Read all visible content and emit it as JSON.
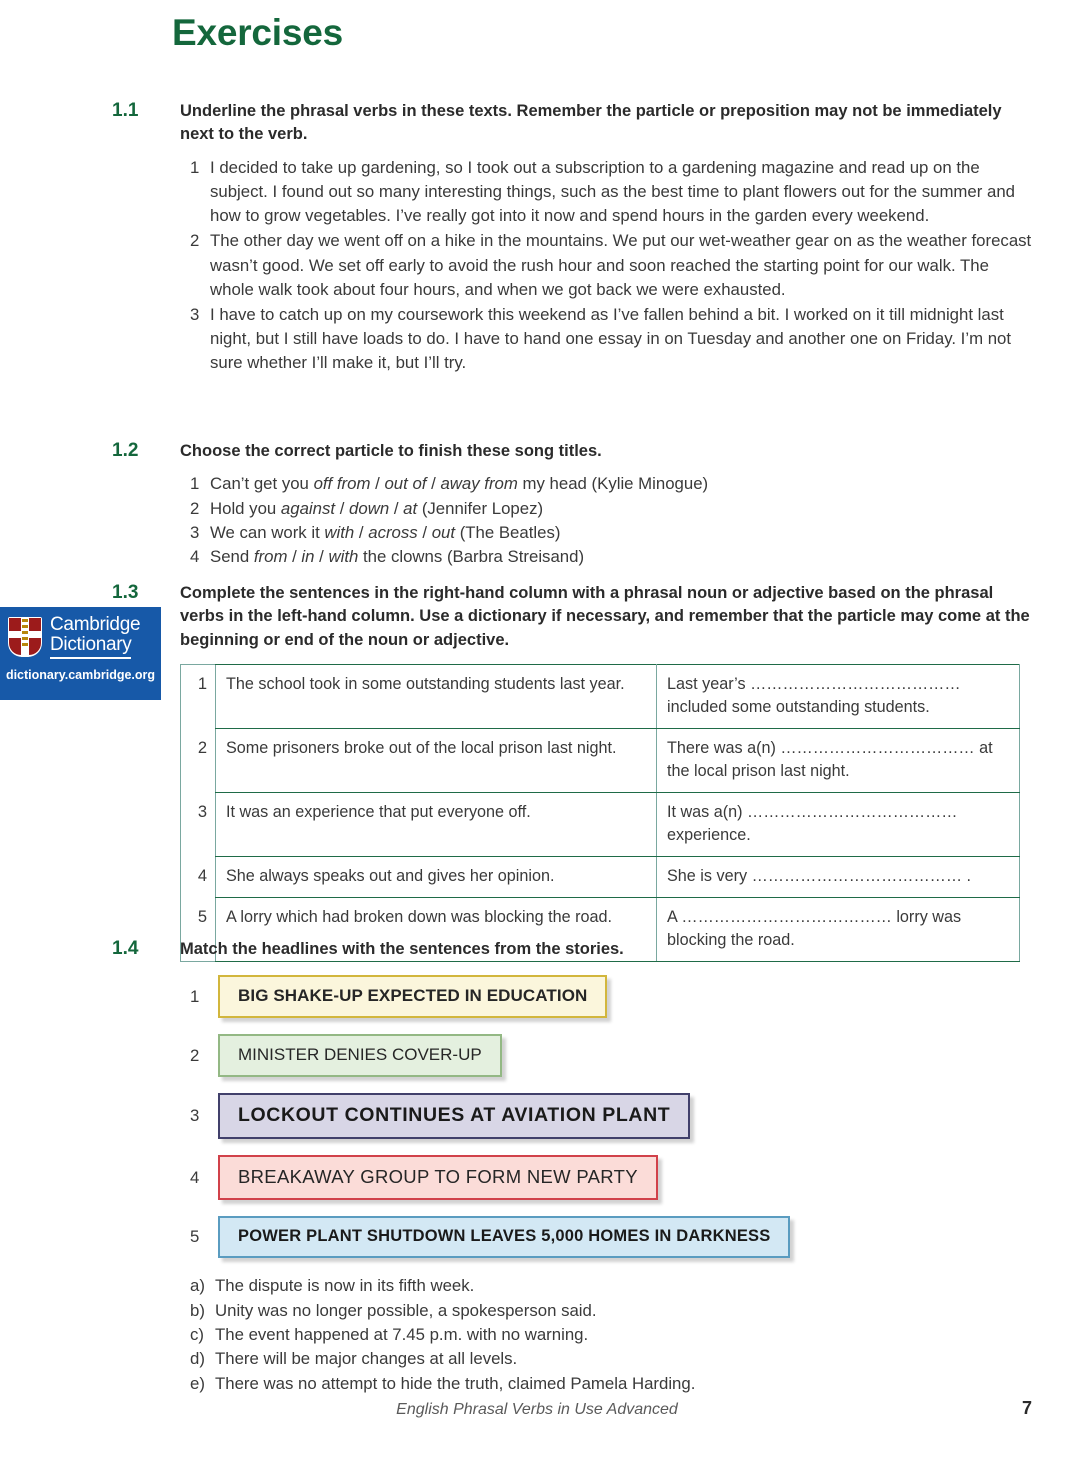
{
  "page_title": "Exercises",
  "footer": {
    "book_title": "English Phrasal Verbs in Use Advanced",
    "page_number": "7"
  },
  "badge": {
    "line1": "Cambridge",
    "line2": "Dictionary",
    "url": "dictionary.cambridge.org"
  },
  "exercises": [
    {
      "number": "1.1",
      "instruction": "Underline the phrasal verbs in these texts. Remember the particle or preposition may not be immediately next to the verb.",
      "items": [
        {
          "n": "1",
          "text": "I decided to take up gardening, so I took out a subscription to a gardening magazine and read up on the subject. I found out so many interesting things, such as the best time to plant flowers out for the summer and how to grow vegetables. I’ve really got into it now and spend hours in the garden every weekend."
        },
        {
          "n": "2",
          "text": "The other day we went off on a hike in the mountains. We put our wet-weather gear on as the weather forecast wasn’t good. We set off early to avoid the rush hour and soon reached the starting point for our walk. The whole walk took about four hours, and when we got back we were exhausted."
        },
        {
          "n": "3",
          "text": "I have to catch up on my coursework this weekend as I’ve fallen behind a bit. I worked on it till midnight last night, but I still have loads to do. I have to hand one essay in on Tuesday and another one on Friday. I’m not sure whether I’ll make it, but I’ll try."
        }
      ]
    },
    {
      "number": "1.2",
      "instruction": "Choose the correct particle to finish these song titles.",
      "items": [
        {
          "n": "1",
          "pre": "Can’t get you ",
          "options": [
            "off from",
            "out of",
            "away from"
          ],
          "post": " my head (Kylie Minogue)"
        },
        {
          "n": "2",
          "pre": "Hold you ",
          "options": [
            "against",
            "down",
            "at"
          ],
          "post": " (Jennifer Lopez)"
        },
        {
          "n": "3",
          "pre": "We can work it ",
          "options": [
            "with",
            "across",
            "out"
          ],
          "post": " (The Beatles)"
        },
        {
          "n": "4",
          "pre": "Send ",
          "options": [
            "from",
            "in",
            "with"
          ],
          "post": " the clowns (Barbra Streisand)"
        }
      ]
    },
    {
      "number": "1.3",
      "instruction": "Complete the sentences in the right-hand column with a phrasal noun or adjective based on the phrasal verbs in the left-hand column. Use a dictionary if necessary, and remember that the particle may come at the beginning or end of the noun or adjective.",
      "rows": [
        {
          "n": "1",
          "left": "The school took in some outstanding students last year.",
          "right": "Last year’s ………………………………… included some outstanding students."
        },
        {
          "n": "2",
          "left": "Some prisoners broke out of the local prison last night.",
          "right": "There was a(n) ……………………………… at the local prison last night."
        },
        {
          "n": "3",
          "left": "It was an experience that put everyone off.",
          "right": "It was a(n) ………………………………… experience."
        },
        {
          "n": "4",
          "left": "She always speaks out and gives her opinion.",
          "right": "She is very ………………………………… ."
        },
        {
          "n": "5",
          "left": "A lorry which had broken down was blocking the road.",
          "right": "A ………………………………… lorry was blocking the road."
        }
      ]
    },
    {
      "number": "1.4",
      "instruction": "Match the headlines with the sentences from the stories.",
      "headlines": [
        {
          "n": "1",
          "text": "BIG SHAKE-UP EXPECTED IN EDUCATION",
          "fill": "#fbf6dc",
          "border": "#d2b63c"
        },
        {
          "n": "2",
          "text": "MINISTER DENIES COVER-UP",
          "fill": "#e4f0df",
          "border": "#93b884"
        },
        {
          "n": "3",
          "text": "LOCKOUT CONTINUES AT AVIATION PLANT",
          "fill": "#d8d6e6",
          "border": "#41406b"
        },
        {
          "n": "4",
          "text": "BREAKAWAY GROUP TO FORM NEW PARTY",
          "fill": "#fbdcd8",
          "border": "#d1414a"
        },
        {
          "n": "5",
          "text": "POWER PLANT SHUTDOWN LEAVES 5,000 HOMES IN DARKNESS",
          "fill": "#d3e8f4",
          "border": "#5a9cc0"
        }
      ],
      "answers": [
        {
          "n": "a)",
          "text": "The dispute is now in its fifth week."
        },
        {
          "n": "b)",
          "text": "Unity was no longer possible, a spokesperson said."
        },
        {
          "n": "c)",
          "text": "The event happened at 7.45 p.m. with no warning."
        },
        {
          "n": "d)",
          "text": "There will be major changes at all levels."
        },
        {
          "n": "e)",
          "text": "There was no attempt to hide the truth, claimed Pamela Harding."
        }
      ]
    }
  ],
  "colors": {
    "heading_green": "#14673c",
    "table_rule": "#1f6b47",
    "badge_blue": "#1759a8"
  }
}
